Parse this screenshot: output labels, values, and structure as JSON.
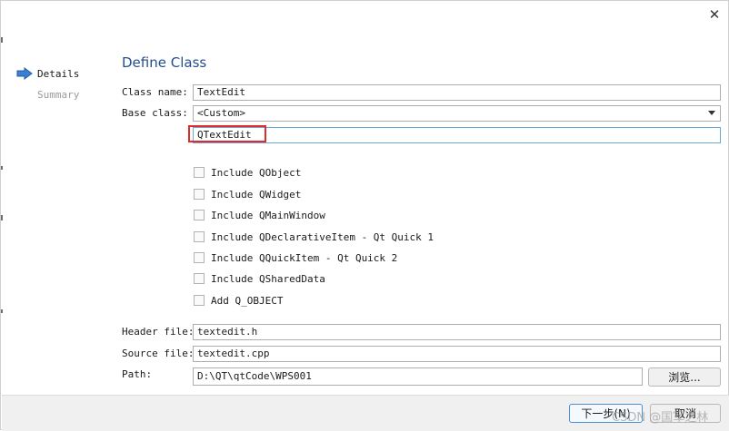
{
  "nav": {
    "items": [
      {
        "label": "Details",
        "active": true
      },
      {
        "label": "Summary",
        "active": false
      }
    ]
  },
  "page": {
    "title": "Define Class"
  },
  "form": {
    "class_name_label": "Class name:",
    "class_name_value": "TextEdit",
    "base_class_label": "Base class:",
    "base_class_value": "<Custom>",
    "custom_base_value": "QTextEdit",
    "checkboxes": [
      {
        "label": "Include QObject",
        "checked": false
      },
      {
        "label": "Include QWidget",
        "checked": false
      },
      {
        "label": "Include QMainWindow",
        "checked": false
      },
      {
        "label": "Include QDeclarativeItem - Qt Quick 1",
        "checked": false
      },
      {
        "label": "Include QQuickItem - Qt Quick 2",
        "checked": false
      },
      {
        "label": "Include QSharedData",
        "checked": false
      },
      {
        "label": "Add Q_OBJECT",
        "checked": false
      }
    ],
    "header_file_label": "Header file:",
    "header_file_value": "textedit.h",
    "source_file_label": "Source file:",
    "source_file_value": "textedit.cpp",
    "path_label": "Path:",
    "path_value": "D:\\QT\\qtCode\\WPS001",
    "browse_label": "浏览..."
  },
  "footer": {
    "next_label": "下一步(N)",
    "cancel_label": "取消"
  },
  "watermark": "CSDN @国军之林",
  "colors": {
    "title": "#254e8c",
    "nav_arrow": "#3a7fd0",
    "highlight_box": "#e12b2b",
    "focus_border": "#6aa8d6"
  }
}
